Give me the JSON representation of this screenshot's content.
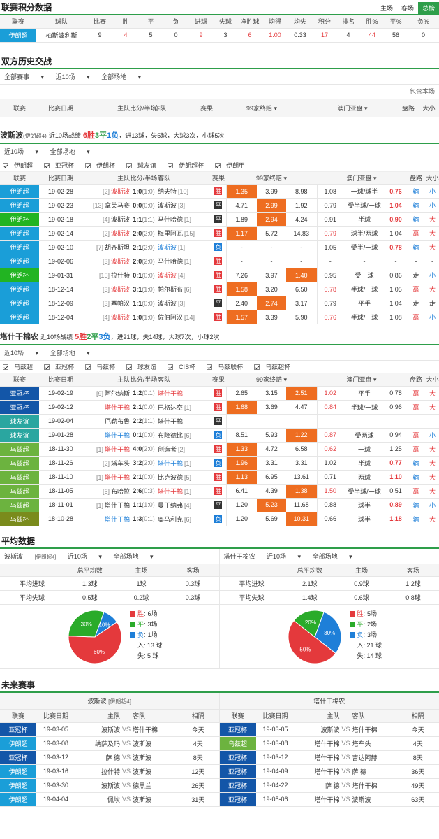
{
  "standings": {
    "title": "联赛积分数据",
    "tabs": [
      "主场",
      "客场",
      "总榜"
    ],
    "headers": [
      "联赛",
      "球队",
      "比赛",
      "胜",
      "平",
      "负",
      "进球",
      "失球",
      "净胜球",
      "均得",
      "均失",
      "积分",
      "排名",
      "胜%",
      "平%",
      "负%"
    ],
    "row": {
      "league": "伊朗超",
      "team": "柏斯波利斯",
      "p": "9",
      "w": "4",
      "d": "5",
      "l": "0",
      "gf": "9",
      "ga": "3",
      "gd": "6",
      "avgf": "1.00",
      "avga": "0.33",
      "pts": "17",
      "rank": "4",
      "wp": "44",
      "dp": "56",
      "lp": "0"
    }
  },
  "h2h": {
    "title": "双方历史交战",
    "f1": "全部赛事",
    "f2": "近10场",
    "f3": "全部场地",
    "include": "包含本场",
    "headers": {
      "league": "联赛",
      "date": "比赛日期",
      "home": "主队",
      "score": "比分/半场",
      "away": "客队",
      "result": "赛果",
      "odds": "99家终赔",
      "asia": "澳门亚盘",
      "pan": "盘路",
      "size": "大小"
    }
  },
  "team1": {
    "name": "波斯波",
    "tag": "(伊朗超4)",
    "sum_pre": "近10场战绩",
    "w": "6胜",
    "d": "3平",
    "l": "1负",
    "sum_post": "，进13球，失5球，大球3次，小球5次",
    "f1": "近10场",
    "f2": "全部场地",
    "checks": [
      "伊朗超",
      "亚冠杯",
      "伊朗杯",
      "球友谊",
      "伊朗超杯",
      "伊朗甲"
    ],
    "rows": [
      {
        "lg": "伊朗超",
        "lc": "#1a9ed8",
        "date": "19-02-28",
        "hr": "[2]",
        "home": "波斯波",
        "ht": "r",
        "sc": "1:0",
        "hf": "(1:0)",
        "away": "纳夫特",
        "ar": "[10]",
        "at": "",
        "res": "胜",
        "rt": "w",
        "o1": "1.35",
        "o2": "3.99",
        "o3": "8.98",
        "oh": 1,
        "a1": "1.08",
        "a2": "一球/球半",
        "a3": "0.76",
        "a3h": 1,
        "pan": "输",
        "pc": "blue",
        "size": "小",
        "sc2": "blue"
      },
      {
        "lg": "伊朗超",
        "lc": "#1a9ed8",
        "date": "19-02-23",
        "hr": "[13]",
        "home": "拿芙马赛",
        "ht": "",
        "sc": "0:0",
        "hf": "(0:0)",
        "away": "波斯波",
        "ar": "[3]",
        "at": "",
        "res": "平",
        "rt": "d",
        "o1": "4.71",
        "o2": "2.99",
        "o3": "1.92",
        "oh": 2,
        "a1": "0.79",
        "a2": "受半球/一球",
        "a3": "1.04",
        "a3h": 1,
        "pan": "输",
        "pc": "blue",
        "size": "小",
        "sc2": "blue"
      },
      {
        "lg": "伊朗杯",
        "lc": "#22b422",
        "date": "19-02-18",
        "hr": "[4]",
        "home": "波斯波",
        "ht": "",
        "sc": "1:1",
        "hf": "(1:1)",
        "away": "马什哈德",
        "ar": "[1]",
        "at": "",
        "res": "平",
        "rt": "d",
        "o1": "1.89",
        "o2": "2.94",
        "o3": "4.24",
        "oh": 2,
        "a1": "0.91",
        "a2": "半球",
        "a3": "0.90",
        "a3h": 1,
        "pan": "输",
        "pc": "blue",
        "size": "大",
        "sc2": "red"
      },
      {
        "lg": "伊朗超",
        "lc": "#1a9ed8",
        "date": "19-02-14",
        "hr": "[2]",
        "home": "波斯波",
        "ht": "r",
        "sc": "2:0",
        "hf": "(2:0)",
        "away": "梅里阿瓦",
        "ar": "[15]",
        "at": "",
        "res": "胜",
        "rt": "w",
        "o1": "1.17",
        "o2": "5.72",
        "o3": "14.83",
        "oh": 1,
        "a1": "0.79",
        "a2": "球半/两球",
        "a3": "1.04",
        "a3h": 0,
        "a1h": 1,
        "pan": "赢",
        "pc": "red",
        "size": "大",
        "sc2": "red"
      },
      {
        "lg": "伊朗超",
        "lc": "#1a9ed8",
        "date": "19-02-10",
        "hr": "[7]",
        "home": "胡齐斯坦",
        "ht": "",
        "sc": "2:1",
        "hf": "(2:0)",
        "away": "波斯波",
        "ar": "[1]",
        "at": "b",
        "res": "负",
        "rt": "l",
        "o1": "-",
        "o2": "-",
        "o3": "-",
        "oh": 0,
        "a1": "1.05",
        "a2": "受半/一球",
        "a3": "0.78",
        "a3h": 1,
        "pan": "输",
        "pc": "blue",
        "size": "大",
        "sc2": "red"
      },
      {
        "lg": "伊朗超",
        "lc": "#1a9ed8",
        "date": "19-02-06",
        "hr": "[3]",
        "home": "波斯波",
        "ht": "r",
        "sc": "2:0",
        "hf": "(2:0)",
        "away": "马什哈德",
        "ar": "[1]",
        "at": "",
        "res": "胜",
        "rt": "w",
        "o1": "-",
        "o2": "-",
        "o3": "-",
        "oh": 0,
        "a1": "-",
        "a2": "-",
        "a3": "-",
        "a3h": 0,
        "pan": "-",
        "pc": "",
        "size": "-",
        "sc2": ""
      },
      {
        "lg": "伊朗杯",
        "lc": "#22b422",
        "date": "19-01-31",
        "hr": "[15]",
        "home": "拉什特",
        "ht": "",
        "sc": "0:1",
        "hf": "(0:0)",
        "away": "波斯波",
        "ar": "[4]",
        "at": "r",
        "res": "胜",
        "rt": "w",
        "o1": "7.26",
        "o2": "3.97",
        "o3": "1.40",
        "oh": 3,
        "a1": "0.95",
        "a2": "受一球",
        "a3": "0.86",
        "a3h": 0,
        "pan": "走",
        "pc": "",
        "size": "小",
        "sc2": "blue"
      },
      {
        "lg": "伊朗超",
        "lc": "#1a9ed8",
        "date": "18-12-14",
        "hr": "[3]",
        "home": "波斯波",
        "ht": "r",
        "sc": "3:1",
        "hf": "(1:0)",
        "away": "帕尔斯布",
        "ar": "[6]",
        "at": "",
        "res": "胜",
        "rt": "w",
        "o1": "1.58",
        "o2": "3.20",
        "o3": "6.50",
        "oh": 1,
        "a1": "0.78",
        "a2": "半球/一球",
        "a3": "1.05",
        "a3h": 0,
        "a1h": 1,
        "pan": "赢",
        "pc": "red",
        "size": "大",
        "sc2": "red"
      },
      {
        "lg": "伊朗超",
        "lc": "#1a9ed8",
        "date": "18-12-09",
        "hr": "[3]",
        "home": "塞帕汉",
        "ht": "",
        "sc": "1:1",
        "hf": "(0:0)",
        "away": "波斯波",
        "ar": "[3]",
        "at": "",
        "res": "平",
        "rt": "d",
        "o1": "2.40",
        "o2": "2.74",
        "o3": "3.17",
        "oh": 2,
        "a1": "0.79",
        "a2": "平手",
        "a3": "1.04",
        "a3h": 0,
        "pan": "走",
        "pc": "",
        "size": "走",
        "sc2": ""
      },
      {
        "lg": "伊朗超",
        "lc": "#1a9ed8",
        "date": "18-12-04",
        "hr": "[4]",
        "home": "波斯波",
        "ht": "r",
        "sc": "1:0",
        "hf": "(1:0)",
        "away": "佐伯阿汉",
        "ar": "[14]",
        "at": "",
        "res": "胜",
        "rt": "w",
        "o1": "1.57",
        "o2": "3.39",
        "o3": "5.90",
        "oh": 1,
        "a1": "0.76",
        "a2": "半球/一球",
        "a3": "1.08",
        "a3h": 0,
        "a1h": 1,
        "pan": "赢",
        "pc": "red",
        "size": "小",
        "sc2": "blue"
      }
    ]
  },
  "team2": {
    "name": "塔什干棉农",
    "sum_pre": "近10场战绩",
    "w": "5胜",
    "d": "2平",
    "l": "3负",
    "sum_post": "，进21球，失14球，大球7次，小球2次",
    "f1": "近10场",
    "f2": "全部场地",
    "checks": [
      "乌兹超",
      "亚冠杯",
      "乌兹杯",
      "球友谊",
      "CIS杯",
      "乌兹联杯",
      "乌兹超杯"
    ],
    "rows": [
      {
        "lg": "亚冠杯",
        "lc": "#1356a8",
        "date": "19-02-19",
        "hr": "[9]",
        "home": "阿尔纳斯",
        "ht": "",
        "sc": "1:2",
        "hf": "(0:1)",
        "away": "塔什干棉",
        "ar": "",
        "at": "r",
        "res": "胜",
        "rt": "w",
        "o1": "2.65",
        "o2": "3.15",
        "o3": "2.51",
        "oh": 3,
        "a1": "1.02",
        "a2": "平手",
        "a3": "0.78",
        "a3h": 0,
        "a1h": 1,
        "pan": "赢",
        "pc": "red",
        "size": "大",
        "sc2": "red"
      },
      {
        "lg": "亚冠杯",
        "lc": "#1356a8",
        "date": "19-02-12",
        "hr": "",
        "home": "塔什干棉",
        "ht": "r",
        "sc": "2:1",
        "hf": "(0:0)",
        "away": "巴格达空",
        "ar": "[1]",
        "at": "",
        "res": "胜",
        "rt": "w",
        "o1": "1.68",
        "o2": "3.69",
        "o3": "4.47",
        "oh": 1,
        "a1": "0.84",
        "a2": "半球/一球",
        "a3": "0.96",
        "a3h": 0,
        "a1h": 1,
        "pan": "赢",
        "pc": "red",
        "size": "大",
        "sc2": "red"
      },
      {
        "lg": "球友谊",
        "lc": "#2aa6a0",
        "date": "19-02-04",
        "hr": "",
        "home": "厄勒布鲁",
        "ht": "",
        "sc": "2:2",
        "hf": "(1:1)",
        "away": "塔什干棉",
        "ar": "",
        "at": "",
        "res": "平",
        "rt": "d",
        "o1": "",
        "o2": "",
        "o3": "",
        "oh": 0,
        "a1": "",
        "a2": "",
        "a3": "",
        "a3h": 0,
        "pan": "",
        "pc": "",
        "size": "",
        "sc2": ""
      },
      {
        "lg": "球友谊",
        "lc": "#2aa6a0",
        "date": "19-01-28",
        "hr": "",
        "home": "塔什干棉",
        "ht": "b",
        "sc": "0:1",
        "hf": "(0:0)",
        "away": "布隆德比",
        "ar": "[6]",
        "at": "",
        "res": "负",
        "rt": "l",
        "o1": "8.51",
        "o2": "5.93",
        "o3": "1.22",
        "oh": 3,
        "a1": "0.87",
        "a2": "受两球",
        "a3": "0.94",
        "a3h": 0,
        "a1h": 1,
        "pan": "赢",
        "pc": "red",
        "size": "小",
        "sc2": "blue"
      },
      {
        "lg": "乌兹超",
        "lc": "#6cb33f",
        "date": "18-11-30",
        "hr": "[1]",
        "home": "塔什干棉",
        "ht": "r",
        "sc": "4:0",
        "hf": "(2:0)",
        "away": "创造者",
        "ar": "[2]",
        "at": "",
        "res": "胜",
        "rt": "w",
        "o1": "1.33",
        "o2": "4.72",
        "o3": "6.58",
        "oh": 1,
        "a1": "0.62",
        "a2": "一球",
        "a3": "1.25",
        "a3h": 0,
        "a1h": 1,
        "pan": "赢",
        "pc": "red",
        "size": "大",
        "sc2": "red"
      },
      {
        "lg": "乌兹超",
        "lc": "#6cb33f",
        "date": "18-11-26",
        "hr": "[2]",
        "home": "塔车头",
        "ht": "",
        "sc": "3:2",
        "hf": "(2:0)",
        "away": "塔什干棉",
        "ar": "[1]",
        "at": "b",
        "res": "负",
        "rt": "l",
        "o1": "1.96",
        "o2": "3.31",
        "o3": "3.31",
        "oh": 1,
        "a1": "1.02",
        "a2": "半球",
        "a3": "0.77",
        "a3h": 1,
        "pan": "输",
        "pc": "blue",
        "size": "大",
        "sc2": "red"
      },
      {
        "lg": "乌兹超",
        "lc": "#6cb33f",
        "date": "18-11-10",
        "hr": "[1]",
        "home": "塔什干棉",
        "ht": "r",
        "sc": "2:1",
        "hf": "(0:0)",
        "away": "比克波德",
        "ar": "[5]",
        "at": "",
        "res": "胜",
        "rt": "w",
        "o1": "1.13",
        "o2": "6.95",
        "o3": "13.61",
        "oh": 1,
        "a1": "0.71",
        "a2": "两球",
        "a3": "1.10",
        "a3h": 1,
        "pan": "输",
        "pc": "blue",
        "size": "大",
        "sc2": "red"
      },
      {
        "lg": "乌兹超",
        "lc": "#6cb33f",
        "date": "18-11-05",
        "hr": "[6]",
        "home": "布哈拉",
        "ht": "",
        "sc": "2:6",
        "hf": "(0:3)",
        "away": "塔什干棉",
        "ar": "[1]",
        "at": "r",
        "res": "胜",
        "rt": "w",
        "o1": "6.41",
        "o2": "4.39",
        "o3": "1.38",
        "oh": 3,
        "a1": "1.50",
        "a2": "受半球/一球",
        "a3": "0.51",
        "a3h": 0,
        "a1h": 1,
        "pan": "赢",
        "pc": "red",
        "size": "大",
        "sc2": "red"
      },
      {
        "lg": "乌兹超",
        "lc": "#6cb33f",
        "date": "18-11-01",
        "hr": "[1]",
        "home": "塔什干棉",
        "ht": "",
        "sc": "1:1",
        "hf": "(1:0)",
        "away": "曼干纳弗",
        "ar": "[4]",
        "at": "",
        "res": "平",
        "rt": "d",
        "o1": "1.20",
        "o2": "5.23",
        "o3": "11.68",
        "oh": 2,
        "a1": "0.88",
        "a2": "球半",
        "a3": "0.89",
        "a3h": 1,
        "pan": "输",
        "pc": "blue",
        "size": "小",
        "sc2": "blue"
      },
      {
        "lg": "乌兹杯",
        "lc": "#7a8b1c",
        "date": "18-10-28",
        "hr": "",
        "home": "塔什干棉",
        "ht": "b",
        "sc": "1:3",
        "hf": "(0:1)",
        "away": "奥马利克",
        "ar": "[6]",
        "at": "",
        "res": "负",
        "rt": "l",
        "o1": "1.20",
        "o2": "5.69",
        "o3": "10.31",
        "oh": 3,
        "a1": "0.66",
        "a2": "球半",
        "a3": "1.18",
        "a3h": 1,
        "pan": "输",
        "pc": "blue",
        "size": "大",
        "sc2": "red"
      }
    ]
  },
  "avg": {
    "title": "平均数据",
    "left": {
      "team": "波斯波",
      "tag": "[伊朗超4]",
      "f1": "近10场",
      "f2": "全部场地",
      "h": [
        "总平均数",
        "主场",
        "客场"
      ],
      "r1": {
        "label": "平均进球",
        "v": [
          "1.3球",
          "1球",
          "0.3球"
        ]
      },
      "r2": {
        "label": "平均失球",
        "v": [
          "0.5球",
          "0.2球",
          "0.3球"
        ]
      },
      "pie": [
        {
          "label": "胜",
          "n": "6场",
          "pct": 60,
          "color": "#e4393c",
          "text": "60%"
        },
        {
          "label": "平",
          "n": "3场",
          "pct": 30,
          "color": "#2aab2a",
          "text": "30%"
        },
        {
          "label": "负",
          "n": "1场",
          "pct": 10,
          "color": "#1e7fd8",
          "text": "10%"
        }
      ],
      "in": "入: 13 球",
      "out": "失: 5 球"
    },
    "right": {
      "team": "塔什干棉农",
      "f1": "近10场",
      "f2": "全部场地",
      "h": [
        "总平均数",
        "主场",
        "客场"
      ],
      "r1": {
        "label": "平均进球",
        "v": [
          "2.1球",
          "0.9球",
          "1.2球"
        ]
      },
      "r2": {
        "label": "平均失球",
        "v": [
          "1.4球",
          "0.6球",
          "0.8球"
        ]
      },
      "pie": [
        {
          "label": "胜",
          "n": "5场",
          "pct": 50,
          "color": "#e4393c",
          "text": "50%"
        },
        {
          "label": "平",
          "n": "2场",
          "pct": 20,
          "color": "#2aab2a",
          "text": "20%"
        },
        {
          "label": "负",
          "n": "3场",
          "pct": 30,
          "color": "#1e7fd8",
          "text": "30%"
        }
      ],
      "in": "入: 21 球",
      "out": "失: 14 球"
    }
  },
  "future": {
    "title": "未来赛事",
    "left": {
      "team": "波斯波",
      "tag": "[伊朗超4]",
      "h": [
        "联赛",
        "比赛日期",
        "主队",
        "客队",
        "相隔"
      ],
      "rows": [
        {
          "lg": "亚冠杯",
          "lc": "#1356a8",
          "date": "19-03-05",
          "home": "波斯波",
          "away": "塔什干棉",
          "gap": "今天"
        },
        {
          "lg": "伊朗超",
          "lc": "#1a9ed8",
          "date": "19-03-08",
          "home": "纳萨及玛",
          "away": "波斯波",
          "gap": "4天"
        },
        {
          "lg": "亚冠杯",
          "lc": "#1356a8",
          "date": "19-03-12",
          "home": "萨 德",
          "away": "波斯波",
          "gap": "8天"
        },
        {
          "lg": "伊朗超",
          "lc": "#1a9ed8",
          "date": "19-03-16",
          "home": "拉什特",
          "away": "波斯波",
          "gap": "12天"
        },
        {
          "lg": "伊朗超",
          "lc": "#1a9ed8",
          "date": "19-03-30",
          "home": "波斯波",
          "away": "德黑兰",
          "gap": "26天"
        },
        {
          "lg": "伊朗超",
          "lc": "#1a9ed8",
          "date": "19-04-04",
          "home": "佩坎",
          "away": "波斯波",
          "gap": "31天"
        }
      ]
    },
    "right": {
      "team": "塔什干棉农",
      "h": [
        "联赛",
        "比赛日期",
        "主队",
        "客队",
        "相隔"
      ],
      "rows": [
        {
          "lg": "亚冠杯",
          "lc": "#1356a8",
          "date": "19-03-05",
          "home": "波斯波",
          "away": "塔什干棉",
          "gap": "今天"
        },
        {
          "lg": "乌兹超",
          "lc": "#6cb33f",
          "date": "19-03-08",
          "home": "塔什干棉",
          "away": "塔车头",
          "gap": "4天"
        },
        {
          "lg": "亚冠杯",
          "lc": "#1356a8",
          "date": "19-03-12",
          "home": "塔什干棉",
          "away": "吉达阿赫",
          "gap": "8天"
        },
        {
          "lg": "亚冠杯",
          "lc": "#1356a8",
          "date": "19-04-09",
          "home": "塔什干棉",
          "away": "萨 德",
          "gap": "36天"
        },
        {
          "lg": "亚冠杯",
          "lc": "#1356a8",
          "date": "19-04-22",
          "home": "萨 德",
          "away": "塔什干棉",
          "gap": "49天"
        },
        {
          "lg": "亚冠杯",
          "lc": "#1356a8",
          "date": "19-05-06",
          "home": "塔什干棉",
          "away": "波斯波",
          "gap": "63天"
        }
      ]
    },
    "vs": "VS"
  }
}
